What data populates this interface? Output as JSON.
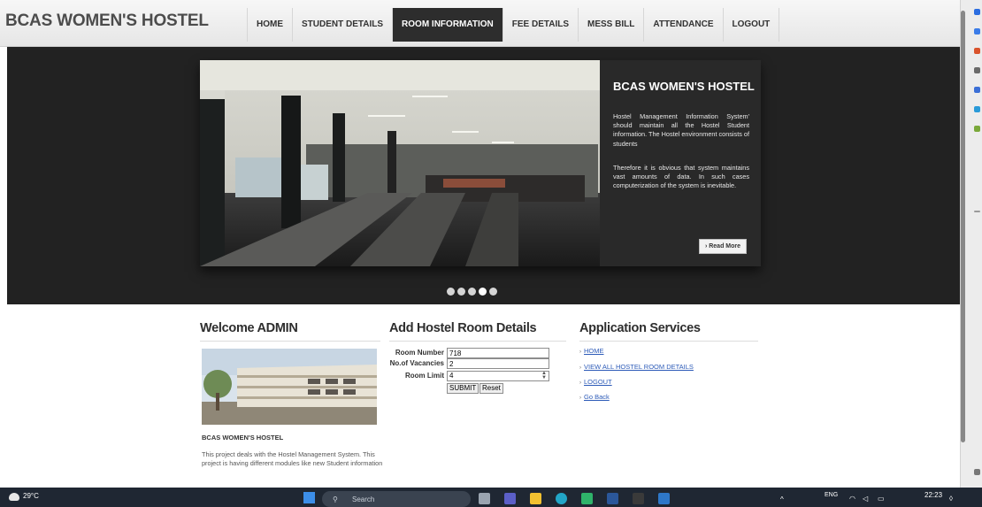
{
  "header": {
    "brand": "BCAS WOMEN'S HOSTEL",
    "nav": [
      "HOME",
      "STUDENT DETAILS",
      "ROOM INFORMATION",
      "FEE DETAILS",
      "MESS BILL",
      "ATTENDANCE",
      "LOGOUT"
    ],
    "active_nav": "ROOM INFORMATION"
  },
  "slider": {
    "caption_title": "BCAS WOMEN'S HOSTEL",
    "paragraph1": "Hostel Management Information System' should maintain all the Hostel Student information. The Hostel environment consists of students",
    "paragraph2": "Therefore it is obvious that system maintains vast amounts of data. In such cases computerization of the system is inevitable.",
    "read_more": "Read More",
    "dot_count": 5,
    "active_dot": 4
  },
  "welcome": {
    "heading": "Welcome ADMIN",
    "title": "BCAS WOMEN'S HOSTEL",
    "text": "This project deals with the Hostel Management System. This project is having different modules like new Student information"
  },
  "form": {
    "heading": "Add Hostel Room Details",
    "room_number_label": "Room Number",
    "room_number_value": "718",
    "vacancies_label": "No.of Vacancies",
    "vacancies_value": "2",
    "room_limit_label": "Room Limit",
    "room_limit_value": "4",
    "submit_label": "SUBMIT",
    "reset_label": "Reset"
  },
  "services": {
    "heading": "Application Services",
    "links": [
      "HOME",
      "VIEW ALL HOSTEL ROOM DETAILS",
      "LOGOUT",
      "Go Back"
    ]
  },
  "taskbar": {
    "weather": "29°C",
    "search": "Search",
    "lang": "ENG",
    "time": "22:23"
  },
  "colors": {
    "active_nav_bg": "#2d2d2d",
    "link": "#2d5bb8",
    "taskbar": "#1f2733"
  }
}
